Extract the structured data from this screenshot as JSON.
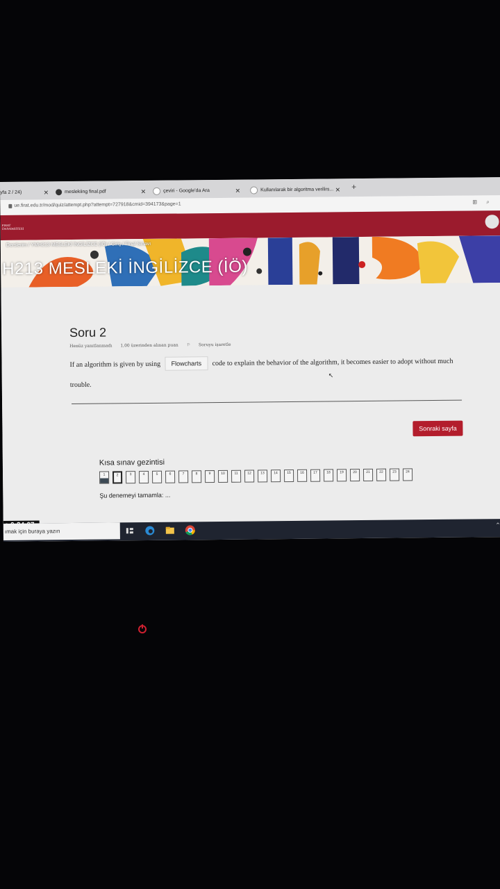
{
  "browser": {
    "tabs": [
      {
        "label": "yfa 2 / 24)"
      },
      {
        "label": "meslekiing final.pdf"
      },
      {
        "label": "çeviri - Google'da Ara"
      },
      {
        "label": "Kullanılarak bir algoritma verilirs..."
      }
    ],
    "new_tab_label": "+",
    "url": "ue.firat.edu.tr/mod/quiz/attempt.php?attempt=727918&cmid=394173&page=1"
  },
  "site": {
    "logo_line1": "FIRAT",
    "logo_line2": "ÜNİVERSİTESİ",
    "breadcrumb": "Derslerim / YMH213 MESLEKİ İNGİLİZCE (İÖ) / Giriş / Final Sınavı",
    "course_title": "H213 MESLEKİ İNGİLİZCE (İÖ)"
  },
  "question": {
    "title": "Soru 2",
    "status": "Henüz yanıtlanmadı",
    "points": "1,00 üzerinden alınan puan",
    "flag_label": "Soruyu işaretle",
    "text_before": "If an algorithm is given by using",
    "answer_value": "Flowcharts",
    "text_after": "code to explain the behavior of the algorithm, it becomes easier to adopt without much trouble."
  },
  "next_button": "Sonraki sayfa",
  "quiz_nav": {
    "title": "Kısa sınav gezintisi",
    "questions": [
      "1",
      "2",
      "3",
      "4",
      "5",
      "6",
      "7",
      "8",
      "9",
      "10",
      "11",
      "12",
      "13",
      "14",
      "15",
      "16",
      "17",
      "18",
      "19",
      "20",
      "21",
      "22",
      "23",
      "24"
    ],
    "answered": [
      1
    ],
    "current": 2,
    "finish_link": "Şu denemeyi tamamla: ..."
  },
  "timer": "e 0:24:07",
  "taskbar": {
    "search_placeholder": "ımak için buraya yazın",
    "icons": [
      "task-view-icon",
      "edge-icon",
      "file-explorer-icon",
      "chrome-icon"
    ]
  },
  "colors": {
    "brand": "#9b1b2d",
    "button": "#b31d2c",
    "answered_fill": "#3d4a55"
  }
}
